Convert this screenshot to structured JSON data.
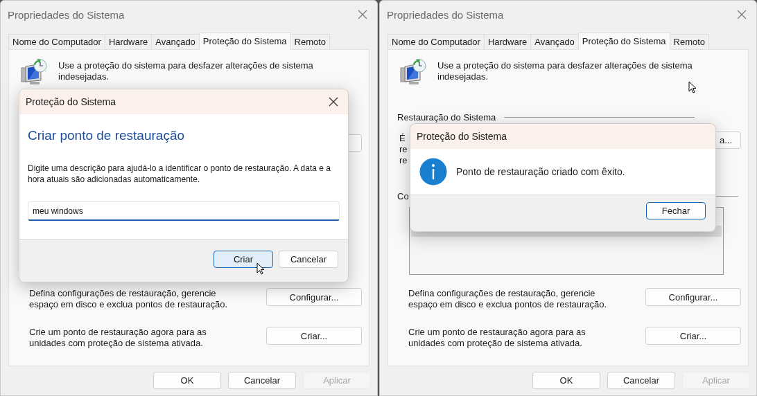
{
  "windows": [
    {
      "title": "Propriedades do Sistema",
      "tabs": [
        {
          "label": "Nome do Computador",
          "selected": false
        },
        {
          "label": "Hardware",
          "selected": false
        },
        {
          "label": "Avançado",
          "selected": false
        },
        {
          "label": "Proteção do Sistema",
          "selected": true
        },
        {
          "label": "Remoto",
          "selected": false
        }
      ],
      "intro": "Use a proteção do sistema para desfazer alterações de sistema indesejadas.",
      "settings_rows": [
        {
          "text": "Defina configurações de restauração, gerencie espaço em disco e exclua pontos de restauração.",
          "button": "Configurar..."
        },
        {
          "text": "Crie um ponto de restauração agora para as unidades com proteção de sistema ativada.",
          "button": "Criar..."
        }
      ],
      "buttons": [
        {
          "label": "OK",
          "disabled": false
        },
        {
          "label": "Cancelar",
          "disabled": false
        },
        {
          "label": "Aplicar",
          "disabled": true
        }
      ],
      "dialog": {
        "kind": "input",
        "title": "Proteção do Sistema",
        "heading": "Criar ponto de restauração",
        "instruction": "Digite uma descrição para ajudá-lo a identificar o ponto de restauração. A data e a hora atuais são adicionadas automaticamente.",
        "input_value": "meu windows",
        "buttons": [
          {
            "label": "Criar",
            "default": true
          },
          {
            "label": "Cancelar",
            "default": false
          }
        ]
      }
    },
    {
      "title": "Propriedades do Sistema",
      "tabs": [
        {
          "label": "Nome do Computador",
          "selected": false
        },
        {
          "label": "Hardware",
          "selected": false
        },
        {
          "label": "Avançado",
          "selected": false
        },
        {
          "label": "Proteção do Sistema",
          "selected": true
        },
        {
          "label": "Remoto",
          "selected": false
        }
      ],
      "intro": "Use a proteção do sistema para desfazer alterações de sistema indesejadas.",
      "behind_dialog": {
        "section_heading": "Restauração do Sistema",
        "description_fragments": [
          "É",
          "re",
          "re"
        ],
        "button_fragment": "a...",
        "section_fragment": "Co"
      },
      "settings_rows": [
        {
          "text": "Defina configurações de restauração, gerencie espaço em disco e exclua pontos de restauração.",
          "button": "Configurar..."
        },
        {
          "text": "Crie um ponto de restauração agora para as unidades com proteção de sistema ativada.",
          "button": "Criar..."
        }
      ],
      "buttons": [
        {
          "label": "OK",
          "disabled": false
        },
        {
          "label": "Cancelar",
          "disabled": false
        },
        {
          "label": "Aplicar",
          "disabled": true
        }
      ],
      "dialog": {
        "kind": "message",
        "title": "Proteção do Sistema",
        "message": "Ponto de restauração criado com êxito.",
        "buttons": [
          {
            "label": "Fechar",
            "default": true
          }
        ]
      }
    }
  ]
}
